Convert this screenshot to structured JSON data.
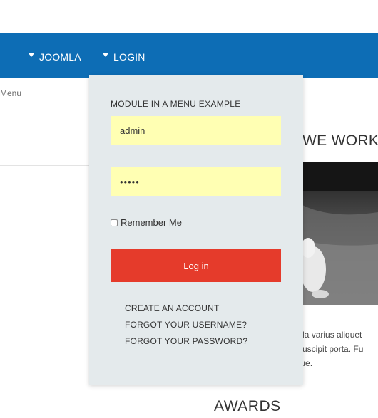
{
  "nav": {
    "items": [
      {
        "label": "JOOMLA"
      },
      {
        "label": "LOGIN"
      }
    ]
  },
  "background": {
    "breadcrumb_fragment": "Menu",
    "section_heading": "Y WE WORK",
    "body_lines": [
      "igula varius aliquet",
      "o suscipit porta. Fu",
      "ugue."
    ],
    "awards_heading": "AWARDS"
  },
  "login_module": {
    "title": "MODULE IN A MENU EXAMPLE",
    "username_value": "admin",
    "password_value": "•••••",
    "remember_label": "Remember Me",
    "login_button": "Log in",
    "links": {
      "create_account": "CREATE AN ACCOUNT",
      "forgot_username": "FORGOT YOUR USERNAME?",
      "forgot_password": "FORGOT YOUR PASSWORD?"
    }
  },
  "colors": {
    "navbar": "#0d6db5",
    "dropdown_bg": "#e4eaec",
    "field_bg": "#ffffb3",
    "button_bg": "#e53b2b"
  }
}
